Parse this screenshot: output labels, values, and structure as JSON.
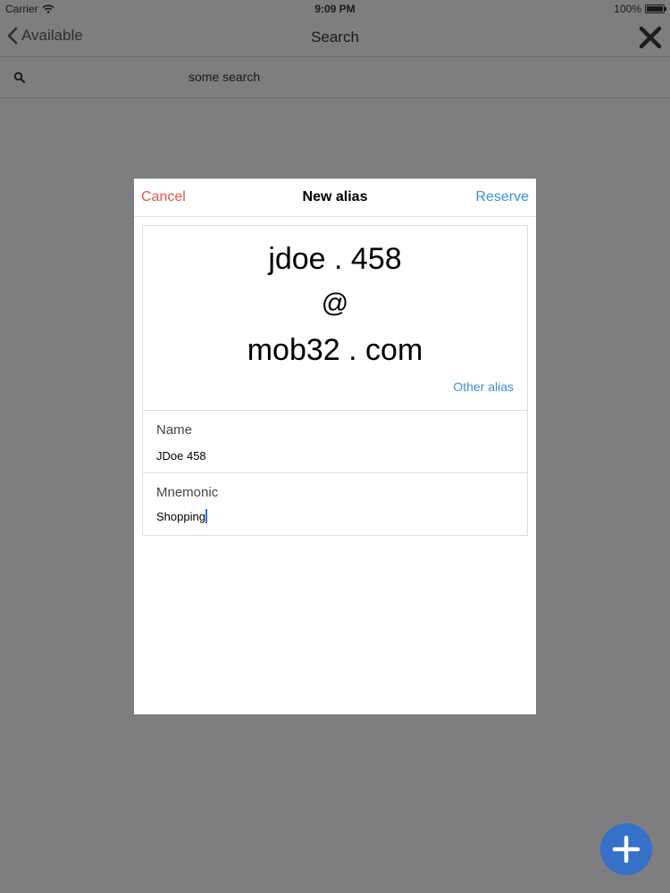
{
  "status_bar": {
    "carrier": "Carrier",
    "time": "9:09 PM",
    "battery": "100%"
  },
  "nav": {
    "back_label": "Available",
    "title": "Search",
    "close_icon": "close-icon"
  },
  "search": {
    "value": "some search",
    "icon": "search-icon"
  },
  "modal": {
    "cancel_label": "Cancel",
    "title": "New alias",
    "reserve_label": "Reserve",
    "alias": {
      "local": "jdoe . 458",
      "at": "@",
      "domain": "mob32 . com",
      "other_alias_label": "Other alias"
    },
    "fields": {
      "name": {
        "label": "Name",
        "value": "JDoe 458"
      },
      "mnemonic": {
        "label": "Mnemonic",
        "value": "Shopping"
      }
    }
  },
  "fab": {
    "icon": "plus-icon"
  },
  "colors": {
    "backdrop": "#7e7e80",
    "cancel": "#e2584a",
    "accent": "#3f8fd8",
    "fab": "#3570c9",
    "caret": "#2f6fd8"
  }
}
